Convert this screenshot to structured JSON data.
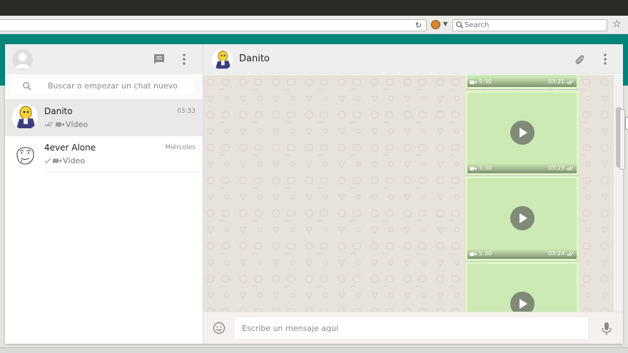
{
  "browser": {
    "url_text": "",
    "search_placeholder": "Search"
  },
  "colors": {
    "brand_teal": "#00857a",
    "bubble_outgoing": "#dcf8c6",
    "chat_background": "#e7e2da"
  },
  "sidebar": {
    "search_placeholder": "Buscar o empezar un chat nuevo",
    "header_icons": [
      "my-avatar",
      "new-chat-icon",
      "menu-icon"
    ],
    "chats": [
      {
        "name": "Danito",
        "time": "03:33",
        "preview": "Vídeo",
        "status": "double-check",
        "active": true
      },
      {
        "name": "4ever Alone",
        "time": "Miércoles",
        "preview": "Vídeo",
        "status": "single-check",
        "active": false
      }
    ]
  },
  "conversation": {
    "contact_name": "Danito",
    "header_icons": [
      "attach-icon",
      "menu-icon"
    ],
    "messages": [
      {
        "type": "video",
        "duration": "5:30",
        "time": "03:21",
        "status": "double-check"
      },
      {
        "type": "video",
        "duration": "5:30",
        "time": "03:23",
        "status": "double-check"
      },
      {
        "type": "video",
        "duration": "5:30",
        "time": "03:24",
        "status": "double-check"
      },
      {
        "type": "video",
        "duration": "",
        "time": "",
        "status": ""
      }
    ],
    "composer_placeholder": "Escribe un mensaje aquí"
  }
}
